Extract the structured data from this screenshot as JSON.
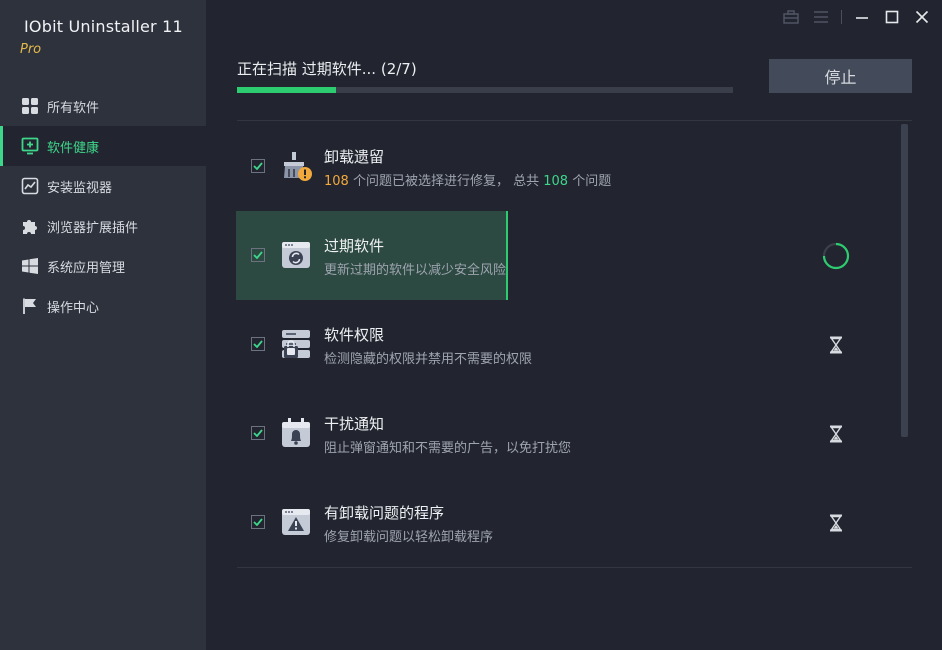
{
  "app": {
    "title": "IObit Uninstaller 11",
    "edition": "Pro"
  },
  "sidebar": {
    "items": [
      {
        "label": "所有软件",
        "icon": "grid-icon",
        "active": false
      },
      {
        "label": "软件健康",
        "icon": "monitor-plus-icon",
        "active": true
      },
      {
        "label": "安装监视器",
        "icon": "chart-line-icon",
        "active": false
      },
      {
        "label": "浏览器扩展插件",
        "icon": "puzzle-icon",
        "active": false
      },
      {
        "label": "系统应用管理",
        "icon": "windows-logo-icon",
        "active": false
      },
      {
        "label": "操作中心",
        "icon": "flag-icon",
        "active": false
      }
    ]
  },
  "scan": {
    "title": "正在扫描 过期软件... (2/7)",
    "progress_percent": 20,
    "stop_label": "停止"
  },
  "items": [
    {
      "title": "卸载遗留",
      "desc_count": "108",
      "desc_mid": " 个问题已被选择进行修复，  总共 ",
      "desc_total": "108",
      "desc_end": " 个问题",
      "status": "done"
    },
    {
      "title": "过期软件",
      "desc": "更新过期的软件以减少安全风险",
      "status": "scanning"
    },
    {
      "title": "软件权限",
      "desc": "检测隐藏的权限并禁用不需要的权限",
      "status": "pending"
    },
    {
      "title": "干扰通知",
      "desc": "阻止弹窗通知和不需要的广告，以免打扰您",
      "status": "pending"
    },
    {
      "title": "有卸载问题的程序",
      "desc": "修复卸载问题以轻松卸载程序",
      "status": "pending"
    }
  ],
  "colors": {
    "accent": "#2ecc71",
    "warning": "#f2a93b",
    "sidebar_bg": "#2d323d",
    "main_bg": "#22252f"
  }
}
